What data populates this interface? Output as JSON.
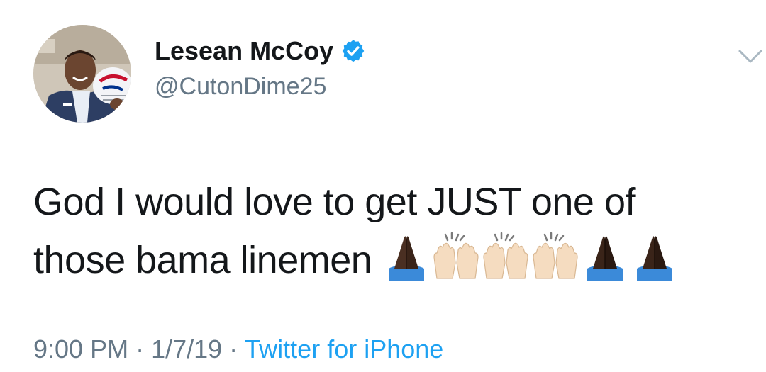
{
  "author": {
    "display_name": "Lesean McCoy",
    "handle": "@CutonDime25",
    "verified": true
  },
  "tweet": {
    "text_line1": "God I would love to get JUST one of",
    "text_line2": "those bama linemen",
    "emojis": [
      "folded-hands-dark",
      "raised-hands-light",
      "raised-hands-light",
      "raised-hands-light",
      "folded-hands-dark",
      "folded-hands-dark"
    ]
  },
  "meta": {
    "time": "9:00 PM",
    "separator": "·",
    "date": "1/7/19",
    "source": "Twitter for iPhone"
  },
  "colors": {
    "name": "#14171a",
    "secondary": "#657786",
    "link": "#1da1f2",
    "verified": "#1da1f2"
  },
  "icons": {
    "verified": "verified-badge-icon",
    "menu": "chevron-down-icon"
  }
}
